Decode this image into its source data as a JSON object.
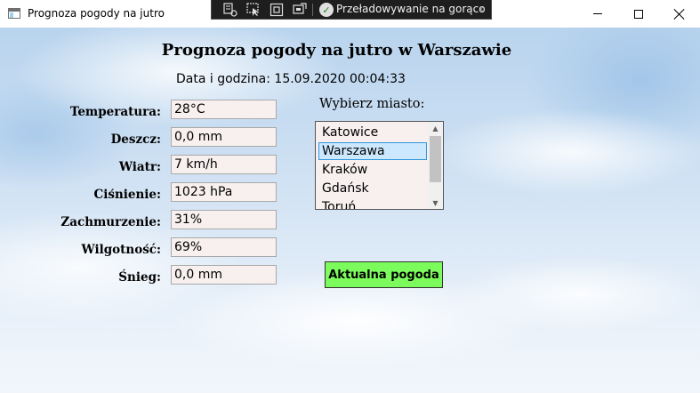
{
  "window": {
    "title": "Prognoza pogody na jutro"
  },
  "debug_toolbar": {
    "hot_reload_label": "Przeładowywanie na gorąco"
  },
  "header": {
    "title": "Prognoza pogody na jutro w Warszawie"
  },
  "datetime": "Data i godzina: 15.09.2020 00:04:33",
  "fields": [
    {
      "label": "Temperatura:",
      "value": "28°C"
    },
    {
      "label": "Deszcz:",
      "value": "0,0 mm"
    },
    {
      "label": "Wiatr:",
      "value": "7 km/h"
    },
    {
      "label": "Ciśnienie:",
      "value": "1023 hPa"
    },
    {
      "label": "Zachmurzenie:",
      "value": "31%"
    },
    {
      "label": "Wilgotność:",
      "value": "69%"
    },
    {
      "label": "Śnieg:",
      "value": "0,0 mm"
    }
  ],
  "city_picker": {
    "label": "Wybierz miasto:",
    "items": [
      "Katowice",
      "Warszawa",
      "Kraków",
      "Gdańsk",
      "Toruń"
    ],
    "selected": "Warszawa"
  },
  "actions": {
    "current_weather_label": "Aktualna pogoda"
  },
  "colors": {
    "button_bg": "#7cfc5c",
    "field_bg": "#f7f0ef",
    "selection_bg": "#cce8ff"
  }
}
